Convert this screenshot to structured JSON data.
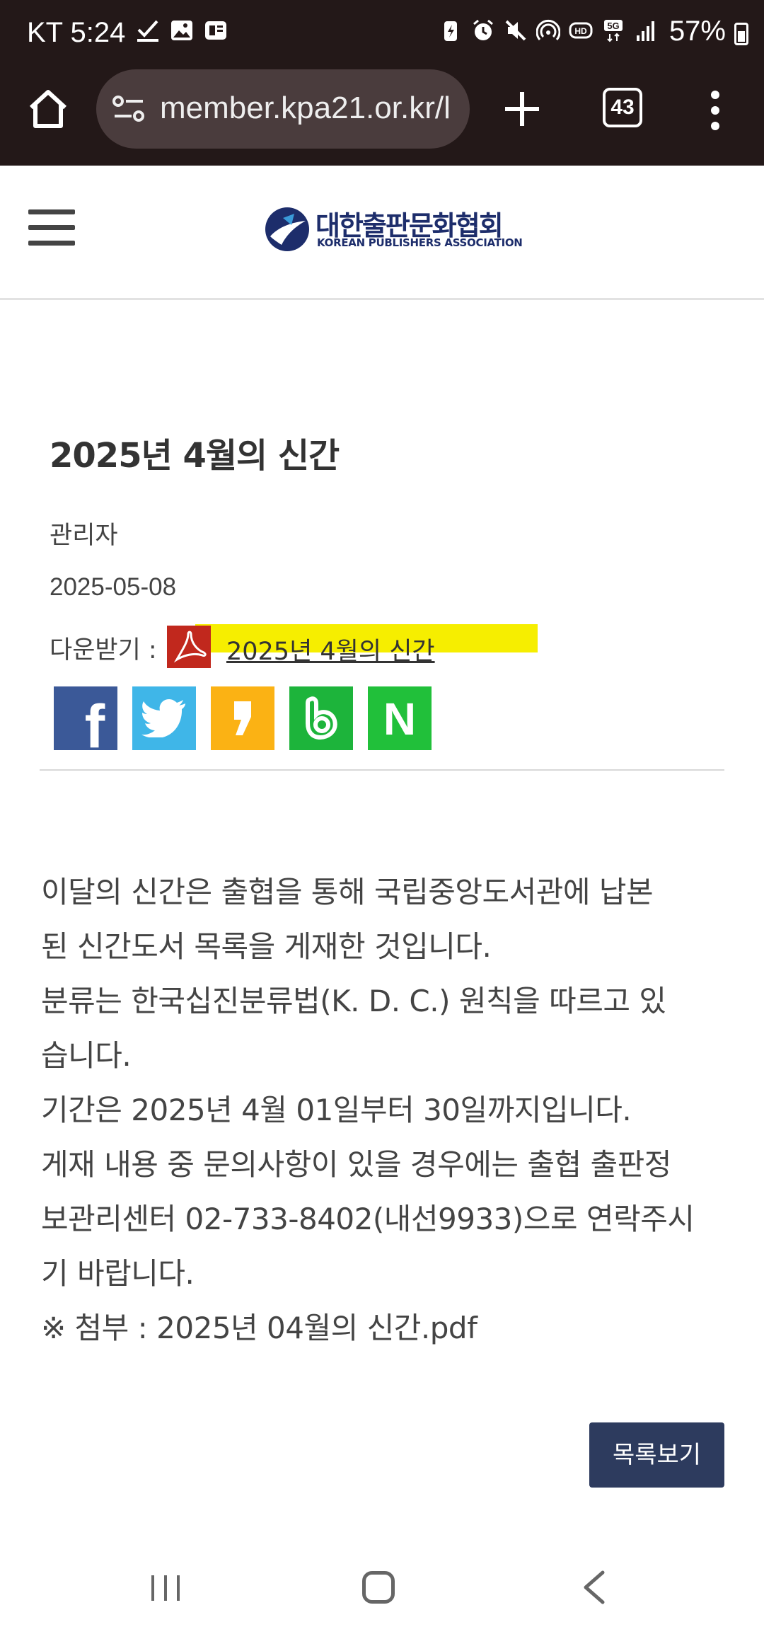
{
  "status_bar": {
    "carrier_time": "KT 5:24",
    "battery_percent": "57%",
    "left_icons": [
      "check-icon",
      "image-icon",
      "news-icon"
    ],
    "right_icons": [
      "battery-saver-icon",
      "alarm-icon",
      "mute-icon",
      "hotspot-icon",
      "hd-icon",
      "5g-icon",
      "signal-icon"
    ],
    "network_badge": "5G"
  },
  "browser": {
    "url": "member.kpa21.or.kr/l",
    "tab_count": "43"
  },
  "site": {
    "logo_korean": "대한출판문화협회",
    "logo_english": "KOREAN PUBLISHERS ASSOCIATION"
  },
  "article": {
    "title": "2025년 4월의 신간",
    "author": "관리자",
    "date": "2025-05-08",
    "download_label": "다운받기 :",
    "download_file": "2025년 4월의 신간",
    "share": [
      {
        "name": "facebook",
        "glyph": "f"
      },
      {
        "name": "twitter",
        "glyph": ""
      },
      {
        "name": "kakaostory",
        "glyph": ""
      },
      {
        "name": "band",
        "glyph": "b"
      },
      {
        "name": "naver",
        "glyph": "N"
      }
    ],
    "body_lines": [
      "이달의 신간은 출협을 통해 국립중앙도서관에 납본\n된 신간도서 목록을 게재한 것입니다.",
      "분류는 한국십진분류법(K. D. C.) 원칙을 따르고 있\n습니다.",
      "기간은 2025년 4월 01일부터 30일까지입니다.",
      "게재 내용 중 문의사항이 있을 경우에는 출협 출판정\n보관리센터 02-733-8402(내선9933)으로 연락주시\n기 바랍니다.",
      "※ 첨부 : 2025년 04월의 신간.pdf"
    ],
    "list_button": "목록보기"
  }
}
